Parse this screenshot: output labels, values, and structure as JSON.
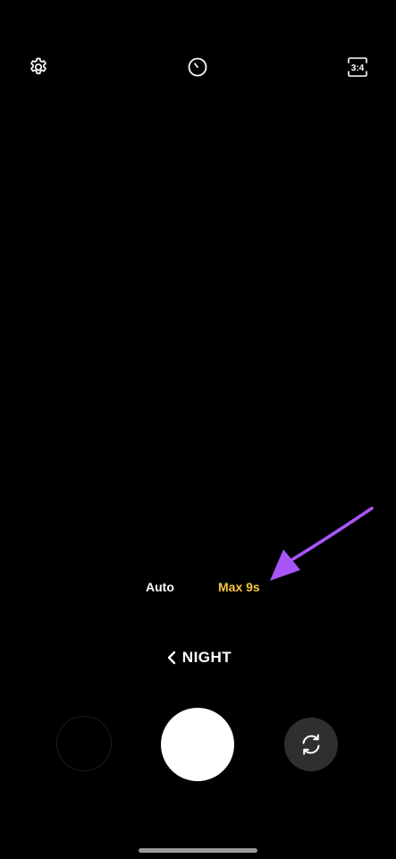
{
  "camera": {
    "top_bar": {
      "settings_icon": "gear-icon",
      "timer_icon": "timer-icon",
      "aspect_ratio_label": "3:4"
    },
    "night_exposure": {
      "options": [
        {
          "label": "Auto",
          "selected": false
        },
        {
          "label": "Max 9s",
          "selected": true
        }
      ],
      "selected_color": "#f4c542"
    },
    "mode": {
      "label": "NIGHT",
      "back_icon": "chevron-left-icon"
    },
    "bottom": {
      "gallery_icon": "gallery-thumbnail",
      "shutter_icon": "shutter-button",
      "flip_icon": "camera-flip-icon"
    },
    "annotation": {
      "arrow_color": "#a855f7"
    }
  }
}
